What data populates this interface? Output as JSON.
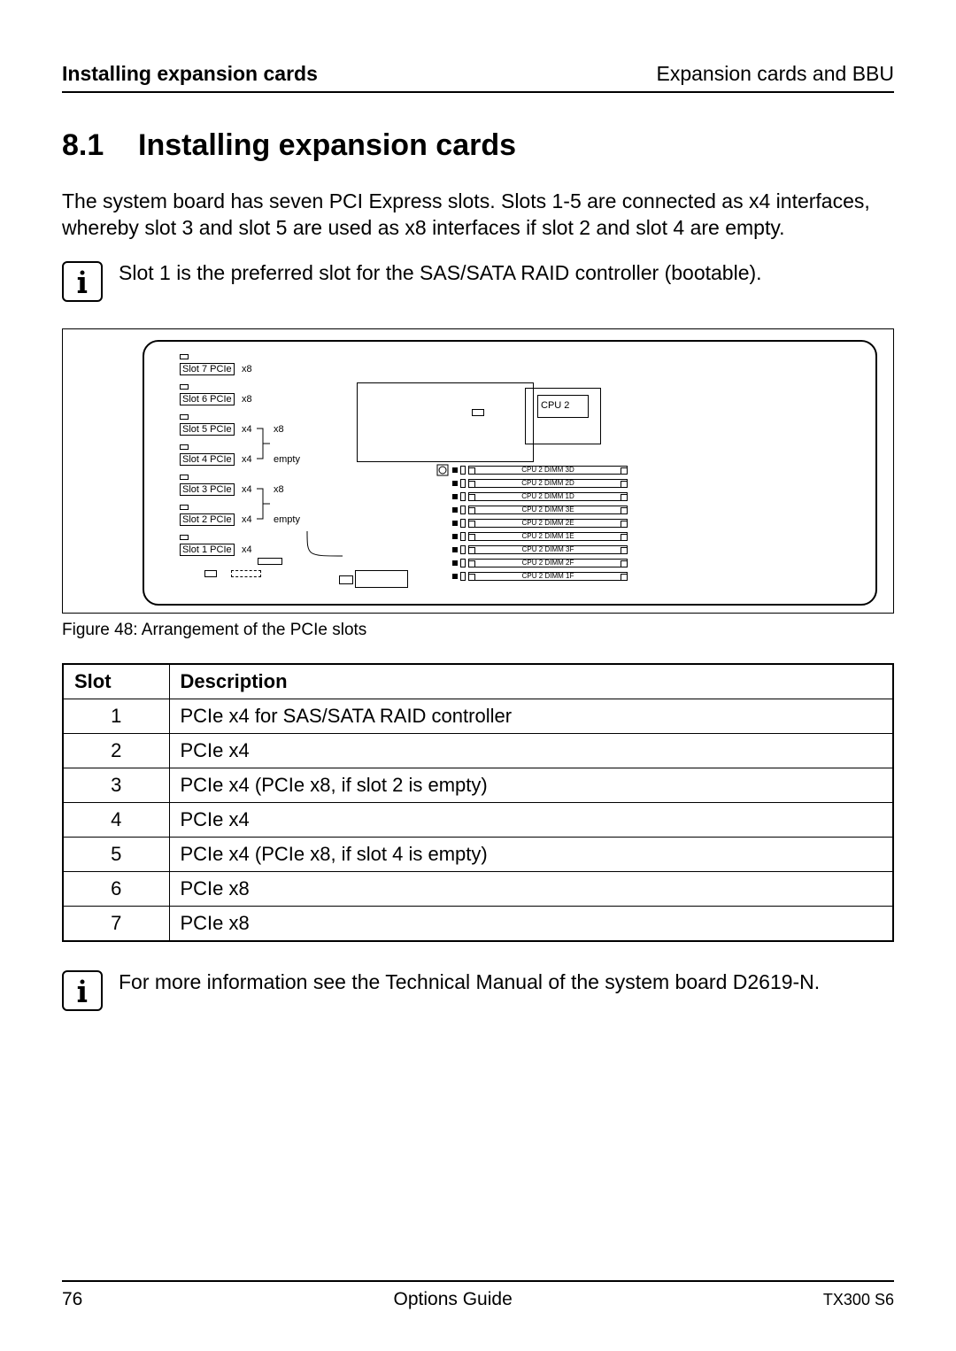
{
  "header": {
    "left": "Installing expansion cards",
    "right": "Expansion cards and BBU"
  },
  "section": {
    "number": "8.1",
    "title": "Installing expansion cards"
  },
  "intro": "The system board has seven PCI Express slots. Slots 1-5 are connected as x4 interfaces, whereby slot 3 and slot 5 are used as x8 interfaces if slot 2 and slot 4 are empty.",
  "info1": "Slot 1 is the preferred slot for the SAS/SATA RAID controller (bootable).",
  "figure": {
    "caption": "Figure 48: Arrangement of the PCIe slots",
    "slots": [
      {
        "label": "Slot 7 PCIe",
        "lanes": "x8"
      },
      {
        "label": "Slot 6 PCIe",
        "lanes": "x8"
      },
      {
        "label": "Slot 5 PCIe",
        "lanes": "x4",
        "bracket_anno": "x8"
      },
      {
        "label": "Slot 4 PCIe",
        "lanes": "x4",
        "bracket_anno": "empty"
      },
      {
        "label": "Slot 3 PCIe",
        "lanes": "x4",
        "bracket_anno": "x8"
      },
      {
        "label": "Slot 2 PCIe",
        "lanes": "x4",
        "bracket_anno": "empty"
      },
      {
        "label": "Slot 1 PCIe",
        "lanes": "x4"
      }
    ],
    "cpu_label": "CPU 2",
    "dimms": [
      "CPU 2 DIMM 3D",
      "CPU 2 DIMM 2D",
      "CPU 2 DIMM 1D",
      "CPU 2 DIMM 3E",
      "CPU 2 DIMM 2E",
      "CPU 2 DIMM 1E",
      "CPU 2 DIMM 3F",
      "CPU 2 DIMM 2F",
      "CPU 2 DIMM 1F"
    ]
  },
  "table": {
    "headers": [
      "Slot",
      "Description"
    ],
    "rows": [
      {
        "slot": "1",
        "desc": "PCIe x4 for SAS/SATA RAID controller"
      },
      {
        "slot": "2",
        "desc": "PCIe x4"
      },
      {
        "slot": "3",
        "desc": "PCIe x4 (PCIe x8, if slot 2 is empty)"
      },
      {
        "slot": "4",
        "desc": "PCIe x4"
      },
      {
        "slot": "5",
        "desc": "PCIe x4 (PCIe x8, if slot 4 is empty)"
      },
      {
        "slot": "6",
        "desc": "PCIe x8"
      },
      {
        "slot": "7",
        "desc": "PCIe x8"
      }
    ]
  },
  "info2": "For more information see the Technical Manual of the system board D2619-N.",
  "footer": {
    "page": "76",
    "center": "Options Guide",
    "right": "TX300 S6"
  }
}
